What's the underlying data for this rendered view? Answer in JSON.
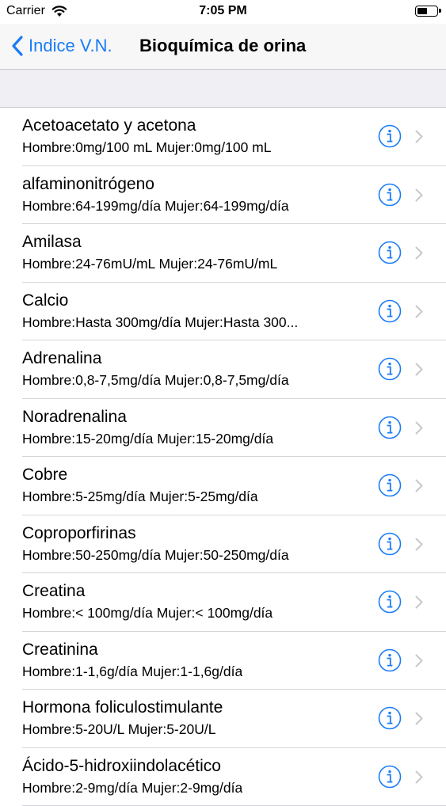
{
  "status_bar": {
    "carrier": "Carrier",
    "time": "7:05 PM"
  },
  "nav": {
    "back_label": "Indice V.N.",
    "title": "Bioquímica de orina"
  },
  "colors": {
    "accent": "#1a7cf5",
    "section_bg": "#efeff4"
  },
  "items": [
    {
      "title": "Acetoacetato y acetona",
      "detail": "Hombre:0mg/100 mL Mujer:0mg/100 mL"
    },
    {
      "title": "alfaminonitrógeno",
      "detail": "Hombre:64-199mg/día Mujer:64-199mg/día"
    },
    {
      "title": "Amilasa",
      "detail": "Hombre:24-76mU/mL Mujer:24-76mU/mL"
    },
    {
      "title": "Calcio",
      "detail": "Hombre:Hasta 300mg/día Mujer:Hasta 300..."
    },
    {
      "title": "Adrenalina",
      "detail": "Hombre:0,8-7,5mg/día Mujer:0,8-7,5mg/día"
    },
    {
      "title": "Noradrenalina",
      "detail": "Hombre:15-20mg/día Mujer:15-20mg/día"
    },
    {
      "title": "Cobre",
      "detail": "Hombre:5-25mg/día Mujer:5-25mg/día"
    },
    {
      "title": "Coproporfirinas",
      "detail": "Hombre:50-250mg/día Mujer:50-250mg/día"
    },
    {
      "title": "Creatina",
      "detail": "Hombre:< 100mg/día Mujer:< 100mg/día"
    },
    {
      "title": "Creatinina",
      "detail": "Hombre:1-1,6g/día Mujer:1-1,6g/día"
    },
    {
      "title": "Hormona foliculostimulante",
      "detail": "Hombre:5-20U/L Mujer:5-20U/L"
    },
    {
      "title": "Ácido-5-hidroxiindolacético",
      "detail": "Hombre:2-9mg/día Mujer:2-9mg/día"
    }
  ]
}
